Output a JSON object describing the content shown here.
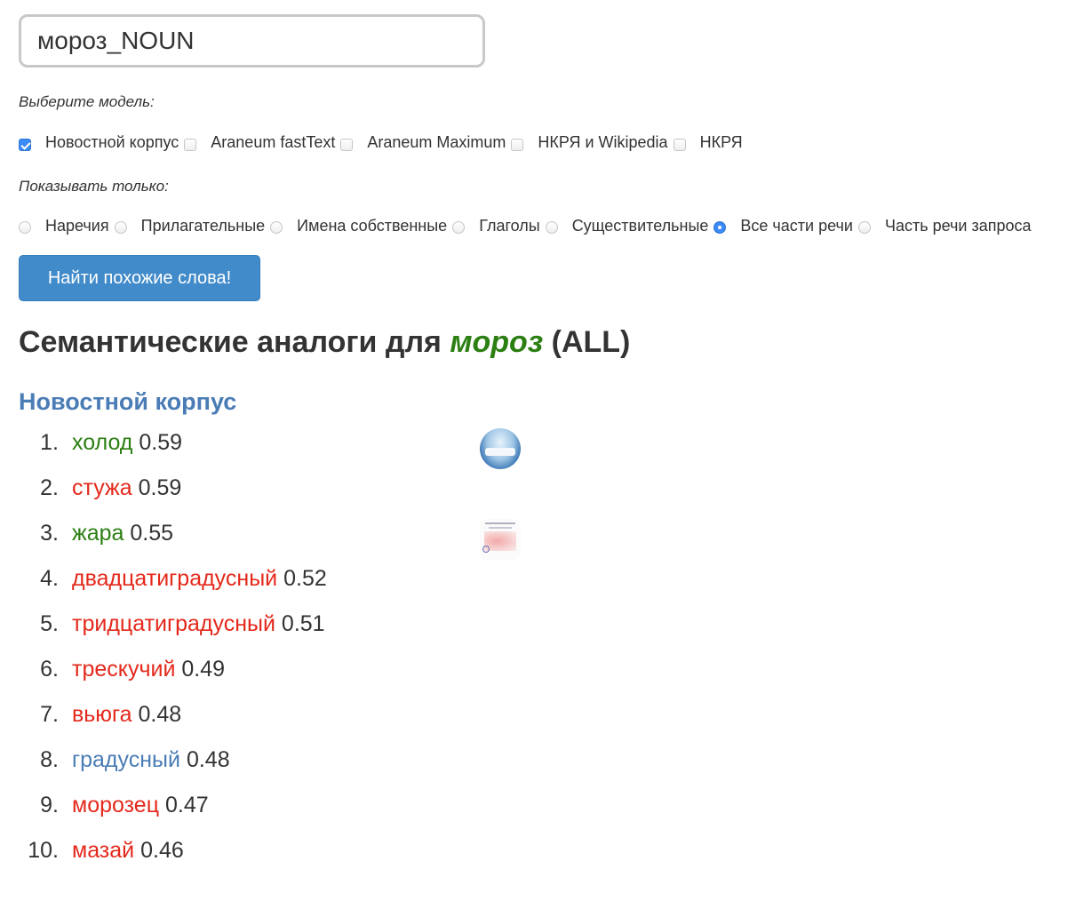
{
  "search": {
    "query": "мороз_NOUN"
  },
  "models": {
    "caption": "Выберите модель:",
    "options": [
      {
        "label": "Новостной корпус",
        "checked": true
      },
      {
        "label": "Araneum fastText",
        "checked": false
      },
      {
        "label": "Araneum Maximum",
        "checked": false
      },
      {
        "label": "НКРЯ и Wikipedia",
        "checked": false
      },
      {
        "label": "НКРЯ",
        "checked": false
      }
    ]
  },
  "pos_filter": {
    "caption": "Показывать только:",
    "options": [
      {
        "label": "Наречия",
        "checked": false
      },
      {
        "label": "Прилагательные",
        "checked": false
      },
      {
        "label": "Имена собственные",
        "checked": false
      },
      {
        "label": "Глаголы",
        "checked": false
      },
      {
        "label": "Существительные",
        "checked": false
      },
      {
        "label": "Все части речи",
        "checked": true
      },
      {
        "label": "Часть речи запроса",
        "checked": false
      }
    ]
  },
  "submit_label": "Найти похожие слова!",
  "heading": {
    "prefix": "Семантические аналоги для ",
    "word": "мороз",
    "suffix": " (ALL)"
  },
  "colors": {
    "green": "#2c7f12",
    "red": "#e4281b",
    "blue": "#4a7cb5"
  },
  "results": {
    "model_title": "Новостной корпус",
    "items": [
      {
        "num": "1.",
        "word": "холод",
        "score": "0.59",
        "color": "green",
        "image": "ice-photo-thumbnail"
      },
      {
        "num": "2.",
        "word": "стужа",
        "score": "0.59",
        "color": "red"
      },
      {
        "num": "3.",
        "word": "жара",
        "score": "0.55",
        "color": "green",
        "image": "heat-map-thumbnail"
      },
      {
        "num": "4.",
        "word": "двадцатиградусный",
        "score": "0.52",
        "color": "red"
      },
      {
        "num": "5.",
        "word": "тридцатиградусный",
        "score": "0.51",
        "color": "red"
      },
      {
        "num": "6.",
        "word": "трескучий",
        "score": "0.49",
        "color": "red"
      },
      {
        "num": "7.",
        "word": "вьюга",
        "score": "0.48",
        "color": "red"
      },
      {
        "num": "8.",
        "word": "градусный",
        "score": "0.48",
        "color": "blue"
      },
      {
        "num": "9.",
        "word": "морозец",
        "score": "0.47",
        "color": "red"
      },
      {
        "num": "10.",
        "word": "мазай",
        "score": "0.46",
        "color": "red"
      }
    ]
  }
}
